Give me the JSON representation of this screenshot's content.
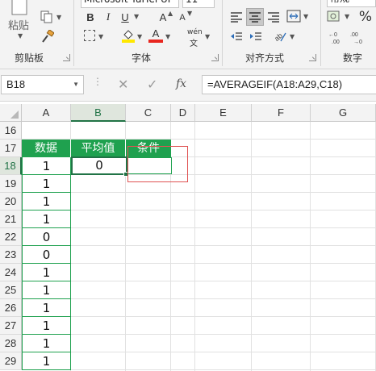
{
  "ribbon": {
    "clipboard": {
      "paste_label": "粘贴",
      "group_label": "剪贴板"
    },
    "font": {
      "font_name": "Microsoft YaHei UI",
      "font_size": "11",
      "bold": "B",
      "italic": "I",
      "underline": "U",
      "grow": "A",
      "shrink": "A",
      "font_color_letter": "A",
      "phonetic_top": "wén",
      "phonetic_bottom": "文",
      "group_label": "字体"
    },
    "alignment": {
      "group_label": "对齐方式"
    },
    "number": {
      "format": "常规",
      "percent": "%",
      "group_label": "数字"
    },
    "accent_color": "#217346"
  },
  "formula_bar": {
    "name_box": "B18",
    "cancel_icon": "close-icon",
    "enter_icon": "check-icon",
    "fx_label": "fx",
    "formula": "=AVERAGEIF(A18:A29,C18)"
  },
  "grid": {
    "columns": [
      "A",
      "B",
      "C",
      "D",
      "E",
      "F",
      "G"
    ],
    "active_column": "B",
    "rows": [
      "16",
      "17",
      "18",
      "19",
      "20",
      "21",
      "22",
      "23",
      "24",
      "25",
      "26",
      "27",
      "28",
      "29"
    ],
    "active_row": "18",
    "headers": {
      "a17": "数据",
      "b17": "平均值",
      "c17": "条件"
    },
    "b18_value": "0",
    "column_a_values": [
      "1",
      "1",
      "1",
      "1",
      "0",
      "0",
      "1",
      "1",
      "1",
      "1",
      "1",
      "1"
    ],
    "header_fill_color": "#1fa14f",
    "highlight_box_color": "#e05353"
  }
}
